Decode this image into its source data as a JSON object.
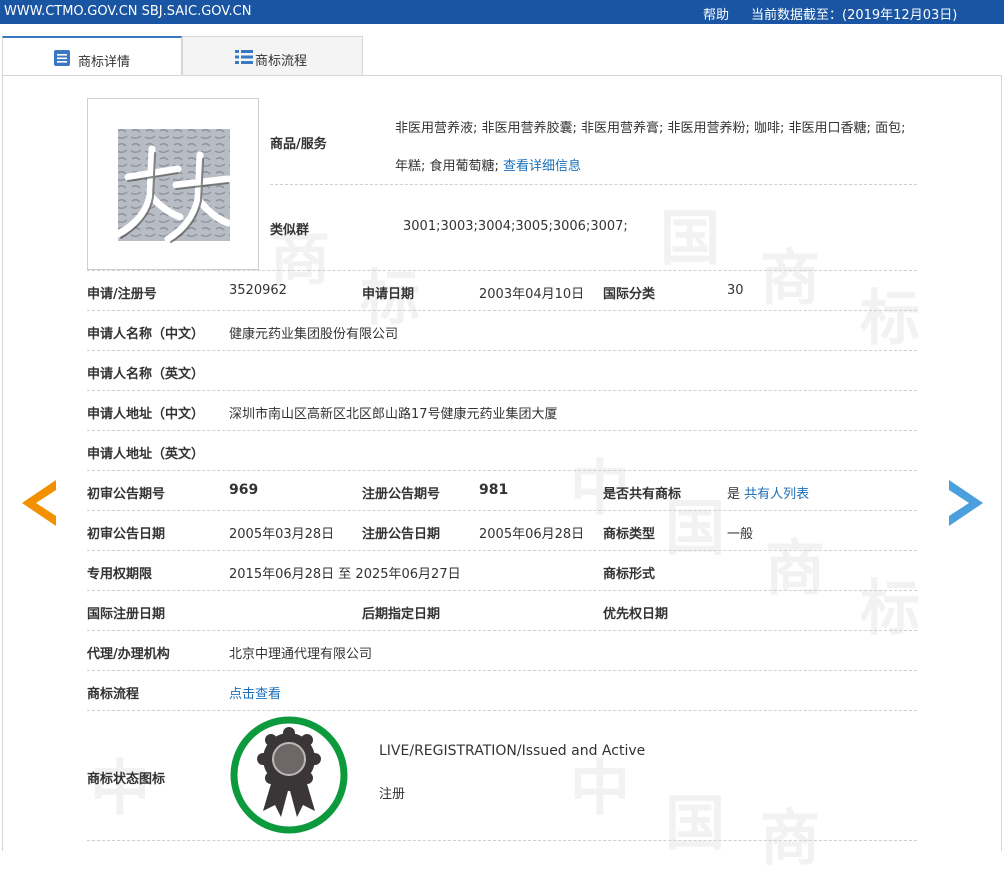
{
  "topbar": {
    "site": "WWW.CTMO.GOV.CN SBJ.SAIC.GOV.CN",
    "help": "帮助",
    "data_date": "当前数据截至：(2019年12月03日)"
  },
  "tabs": [
    {
      "label": "商标详情",
      "icon": "list-doc-icon"
    },
    {
      "label": "商标流程",
      "icon": "list-icon"
    }
  ],
  "watermark": {
    "chars": [
      "中",
      "国",
      "商",
      "标"
    ]
  },
  "detail": {
    "goods": {
      "label": "商品/服务",
      "value": "非医用营养液; 非医用营养胶囊; 非医用营养膏; 非医用营养粉; 咖啡; 非医用口香糖; 面包; 年糕; 食用葡萄糖;",
      "link": "查看详细信息"
    },
    "similar_group": {
      "label": "类似群",
      "value": "3001;3003;3004;3005;3006;3007;"
    },
    "reg_no": {
      "label": "申请/注册号",
      "value": "3520962"
    },
    "app_date": {
      "label": "申请日期",
      "value": "2003年04月10日"
    },
    "intl_class": {
      "label": "国际分类",
      "value": "30"
    },
    "applicant_cn": {
      "label": "申请人名称（中文）",
      "value": "健康元药业集团股份有限公司"
    },
    "applicant_en": {
      "label": "申请人名称（英文）",
      "value": ""
    },
    "address_cn": {
      "label": "申请人地址（中文）",
      "value": "深圳市南山区高新区北区郎山路17号健康元药业集团大厦"
    },
    "address_en": {
      "label": "申请人地址（英文）",
      "value": ""
    },
    "prelim_issue": {
      "label": "初审公告期号",
      "value": "969"
    },
    "reg_issue": {
      "label": "注册公告期号",
      "value": "981"
    },
    "shared": {
      "label": "是否共有商标",
      "value": "是",
      "link": "共有人列表"
    },
    "prelim_date": {
      "label": "初审公告日期",
      "value": "2005年03月28日"
    },
    "reg_date": {
      "label": "注册公告日期",
      "value": "2005年06月28日"
    },
    "tm_type": {
      "label": "商标类型",
      "value": "一般"
    },
    "exclusive": {
      "label": "专用权期限",
      "value": "2015年06月28日 至 2025年06月27日"
    },
    "tm_form": {
      "label": "商标形式",
      "value": ""
    },
    "intl_reg_date": {
      "label": "国际注册日期",
      "value": ""
    },
    "later_date": {
      "label": "后期指定日期",
      "value": ""
    },
    "priority_date": {
      "label": "优先权日期",
      "value": ""
    },
    "agent": {
      "label": "代理/办理机构",
      "value": "北京中理通代理有限公司"
    },
    "process": {
      "label": "商标流程",
      "link": "点击查看"
    },
    "status": {
      "label": "商标状态图标",
      "en": "LIVE/REGISTRATION/Issued and Active",
      "cn": "注册",
      "badge_icon": "award-ribbon-icon",
      "badge_ring_color": "#0c9a3c"
    }
  },
  "nav": {
    "prev_icon": "prev-arrow-icon",
    "next_icon": "next-arrow-icon",
    "prev_color": "#f39000",
    "next_color": "#4a9fdc"
  }
}
